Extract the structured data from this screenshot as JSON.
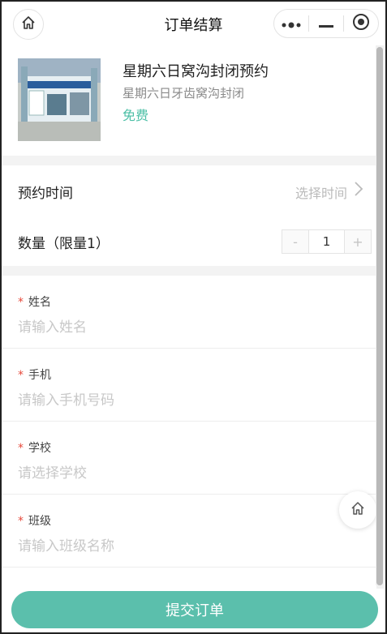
{
  "navbar": {
    "title": "订单结算",
    "home_icon": "home-icon",
    "capsule": {
      "more_icon": "more-dots-icon",
      "minimize_icon": "minimize-icon",
      "close_icon": "target-close-icon"
    }
  },
  "product": {
    "title": "星期六日窝沟封闭预约",
    "subtitle": "星期六日牙齿窝沟封闭",
    "price": "免费",
    "image_desc": "clinic-building-photo"
  },
  "booking": {
    "time_label": "预约时间",
    "time_value": "选择时间",
    "quantity_label": "数量（限量1）",
    "quantity_minus": "-",
    "quantity_value": "1",
    "quantity_plus": "+"
  },
  "form": {
    "fields": [
      {
        "label": "姓名",
        "placeholder": "请输入姓名"
      },
      {
        "label": "手机",
        "placeholder": "请输入手机号码"
      },
      {
        "label": "学校",
        "placeholder": "请选择学校"
      },
      {
        "label": "班级",
        "placeholder": "请输入班级名称"
      }
    ],
    "required_mark": "*"
  },
  "submit_label": "提交订单",
  "colors": {
    "accent": "#5bbfac",
    "price": "#4cbfa6",
    "required": "#e64a3c",
    "placeholder": "#c8c8c8"
  }
}
